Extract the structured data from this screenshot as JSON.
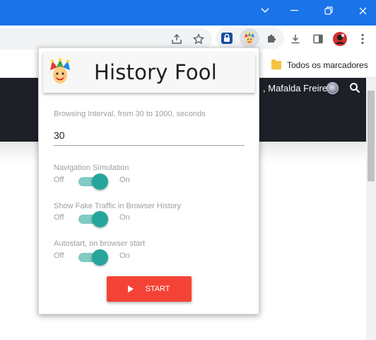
{
  "browser": {
    "bookmark_folder_label": "Todos os marcadores",
    "user_name": "Mafalda Freire"
  },
  "extension": {
    "title": "History Fool",
    "interval": {
      "label": "Browsing Interval, from 30 to 1000, seconds",
      "value": "30"
    },
    "switches": [
      {
        "label": "Navigation Simulation",
        "off_label": "Off",
        "on_label": "On",
        "state": "on"
      },
      {
        "label": "Show Fake Traffic in Browser History",
        "off_label": "Off",
        "on_label": "On",
        "state": "on"
      },
      {
        "label": "Autostart, on browser start",
        "off_label": "Off",
        "on_label": "On",
        "state": "on"
      }
    ],
    "start_label": "START"
  },
  "colors": {
    "chrome_titlebar": "#1a73e8",
    "page_header": "#1d2027",
    "switch_knob": "#26a69a",
    "switch_track": "#80cbc4",
    "start_button": "#f44336"
  },
  "icons": [
    "chevron-down-icon",
    "minimize-icon",
    "restore-icon",
    "close-icon",
    "share-icon",
    "star-icon",
    "extension-lock-icon",
    "jester-icon",
    "puzzle-icon",
    "download-icon",
    "side-panel-icon",
    "profile-avatar",
    "kebab-menu-icon",
    "folder-icon",
    "search-icon",
    "play-icon"
  ]
}
